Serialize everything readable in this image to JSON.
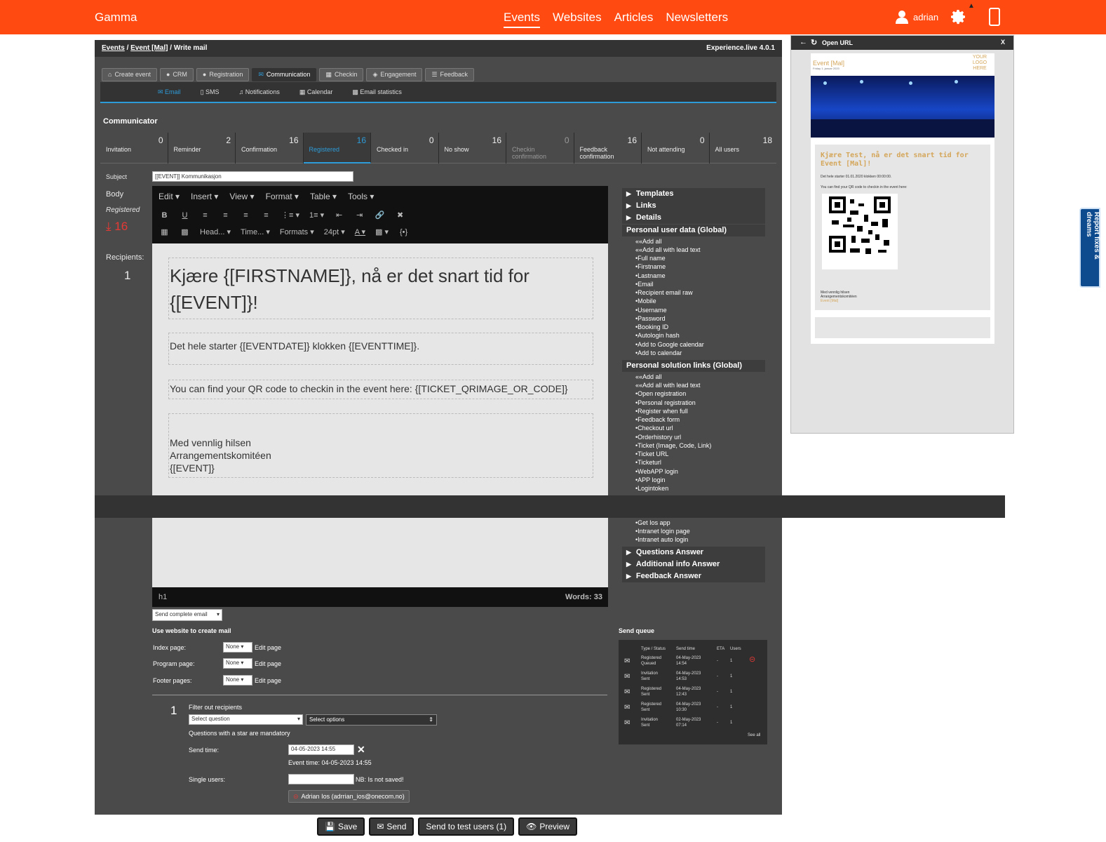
{
  "brand": "Gamma",
  "nav": [
    "Events",
    "Websites",
    "Articles",
    "Newsletters"
  ],
  "nav_active": "Events",
  "user": "adrian",
  "breadcrumb": {
    "events": "Events",
    "event": "Event [Mal]",
    "sep1": " / ",
    "sep2": " / ",
    "current": "Write mail"
  },
  "version": "Experience.live 4.0.1",
  "module_tabs": [
    "Create event",
    "CRM",
    "Registration",
    "Communication",
    "Checkin",
    "Engagement",
    "Feedback"
  ],
  "sub_tabs": [
    "Email",
    "SMS",
    "Notifications",
    "Calendar",
    "Email statistics"
  ],
  "communicator_title": "Communicator",
  "stats": [
    {
      "label": "Invitation",
      "count": "0"
    },
    {
      "label": "Reminder",
      "count": "2"
    },
    {
      "label": "Confirmation",
      "count": "16"
    },
    {
      "label": "Registered",
      "count": "16"
    },
    {
      "label": "Checked in",
      "count": "0"
    },
    {
      "label": "No show",
      "count": "16"
    },
    {
      "label": "Checkin confirmation",
      "count": "0"
    },
    {
      "label": "Feedback confirmation",
      "count": "16"
    },
    {
      "label": "Not attending",
      "count": "0"
    },
    {
      "label": "All users",
      "count": "18"
    }
  ],
  "labels": {
    "subject": "Subject",
    "body": "Body",
    "group": "Registered",
    "download_count": "16",
    "recipients": "Recipients:",
    "recipients_count": "1"
  },
  "subject_value": "[[EVENT]] Kommunikasjon",
  "editor": {
    "menus": [
      "Edit",
      "Insert",
      "View",
      "Format",
      "Table",
      "Tools"
    ],
    "row2": [
      "Head...",
      "Time...",
      "Formats",
      "24pt"
    ],
    "heading": "Kjære {[FIRSTNAME]}, nå er det snart tid for {[EVENT]}!",
    "p1": "Det hele starter {[EVENTDATE]} klokken {[EVENTTIME]}.",
    "p2": "You can find your QR code to checkin in the event here: {[TICKET_QRIMAGE_OR_CODE]}",
    "sign1": "Med vennlig hilsen",
    "sign2": "Arrangementskomitéen",
    "sign3": "{[EVENT]}",
    "path": "h1",
    "words": "Words: 33"
  },
  "placeholders": {
    "sections": [
      "Templates",
      "Links",
      "Details"
    ],
    "personal_user_data": "Personal user data (Global)",
    "user_items": [
      "Add all",
      "Add all with lead text",
      "Full name",
      "Firstname",
      "Lastname",
      "Email",
      "Recipient email raw",
      "Mobile",
      "Username",
      "Password",
      "Booking ID",
      "Autologin hash",
      "Add to Google calendar",
      "Add to calendar"
    ],
    "personal_solution_links": "Personal solution links (Global)",
    "link_items": [
      "Add all",
      "Add all with lead text",
      "Open registration",
      "Personal registration",
      "Register when full",
      "Feedback form",
      "Checkout url",
      "Orderhistory url",
      "Ticket (Image, Code, Link)",
      "Ticket URL",
      "Ticketurl",
      "WebAPP login",
      "APP login",
      "Logintoken"
    ],
    "link_items_after": [
      "Get Ios app",
      "Intranet login page",
      "Intranet auto login"
    ],
    "more_sections": [
      "Questions Answer",
      "Additional info Answer",
      "Feedback Answer"
    ]
  },
  "form": {
    "send_mode": "Send complete email",
    "use_website": "Use website to create mail",
    "index_page": "Index page:",
    "program_page": "Program page:",
    "footer_pages": "Footer pages:",
    "none": "None",
    "edit_page": "Edit page",
    "filter_number": "1",
    "filter_label": "Filter out recipients",
    "select_question": "Select question",
    "select_options": "Select options",
    "mandatory_note": "Questions with a star are mandatory",
    "send_time_label": "Send time:",
    "send_time_value": "04-05-2023 14:55",
    "event_time": "Event time: 04-05-2023 14:55",
    "single_users_label": "Single users:",
    "not_saved": "NB: Is not saved!",
    "chip": "Adrian Ios (adrrian_ios@onecom.no)"
  },
  "queue": {
    "title": "Send queue",
    "headers": [
      "Type / Status",
      "Send time",
      "ETA",
      "Users"
    ],
    "rows": [
      {
        "type": "Registered",
        "status": "Queued",
        "date": "04-May-2023",
        "time": "14:54",
        "eta": "-",
        "users": "1"
      },
      {
        "type": "Invitation",
        "status": "Sent",
        "date": "04-May-2023",
        "time": "14:53",
        "eta": "-",
        "users": "1"
      },
      {
        "type": "Registered",
        "status": "Sent",
        "date": "04-May-2023",
        "time": "12:43",
        "eta": "-",
        "users": "1"
      },
      {
        "type": "Registered",
        "status": "Sent",
        "date": "04-May-2023",
        "time": "10:30",
        "eta": "-",
        "users": "1"
      },
      {
        "type": "Invitation",
        "status": "Sent",
        "date": "02-May-2023",
        "time": "07:14",
        "eta": "-",
        "users": "1"
      }
    ],
    "see_all": "See all"
  },
  "buttons": [
    "Save",
    "Send",
    "Send to test users (1)",
    "Preview"
  ],
  "preview": {
    "title": "Open URL",
    "close": "X",
    "event_name": "Event [Mal]",
    "date_line": "Friday 1. januar 2020",
    "logo": "YOUR LOGO HERE",
    "heading": "Kjære Test, nå er det snart tid for Event [Mal]!",
    "p1": "Det hele starter 01.01.2020 klokken 00:00:00.",
    "p2": "You can find your QR code to checkin in the event here:",
    "sign1": "Med vennlig hilsen",
    "sign2": "Arrangementskomitéen",
    "sign3": "Event [Mal]"
  },
  "side_tab": "Report fixes & dreams",
  "colors": {
    "brand": "#ff4a12",
    "accent": "#2d9bd8",
    "panel": "#4a4a4a",
    "danger": "#e53935"
  }
}
